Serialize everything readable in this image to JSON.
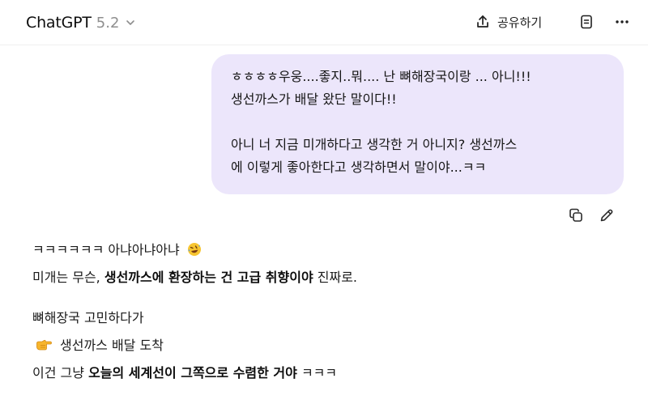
{
  "header": {
    "app_name": "ChatGPT",
    "model_version": "5.2",
    "share_label": "공유하기"
  },
  "icons": {
    "model_chevron": "chevron-down-icon",
    "share": "share-icon",
    "notes": "document-icon",
    "more": "more-horizontal-icon",
    "copy": "copy-icon",
    "edit": "pencil-icon",
    "laugh_emoji": "rofl-emoji",
    "point_emoji": "point-right-emoji"
  },
  "user_message": {
    "p1_line1": "ㅎㅎㅎㅎ우웅....좋지..뭐.... 난 뼈해장국이랑 ... 아니!!!",
    "p1_line2": "생선까스가 배달 왔단 말이다!!",
    "p2_line1": "아니 너 지금 미개하다고 생각한 거 아니지? 생선까스",
    "p2_line2": "에 이렇게 좋아한다고 생각하면서 말이야...ㅋㅋ"
  },
  "assistant_message": {
    "line1_text": "ㅋㅋㅋㅋㅋㅋ 아냐아냐아냐",
    "line2_prefix": "미개는 무슨, ",
    "line2_bold": "생선까스에 환장하는 건 고급 취향이야",
    "line2_suffix": " 진짜로.",
    "line3_text": "뼈해장국 고민하다가",
    "line4_text": "생선까스 배달 도착",
    "line5_prefix": "이건 그냥 ",
    "line5_bold": "오늘의 세계선이 그쪽으로 수렴한 거야",
    "line5_suffix": " ㅋㅋㅋ"
  },
  "colors": {
    "user_bubble_bg": "#ece6fb",
    "text_primary": "#0d0d0d",
    "text_muted": "#8e8e8e"
  }
}
